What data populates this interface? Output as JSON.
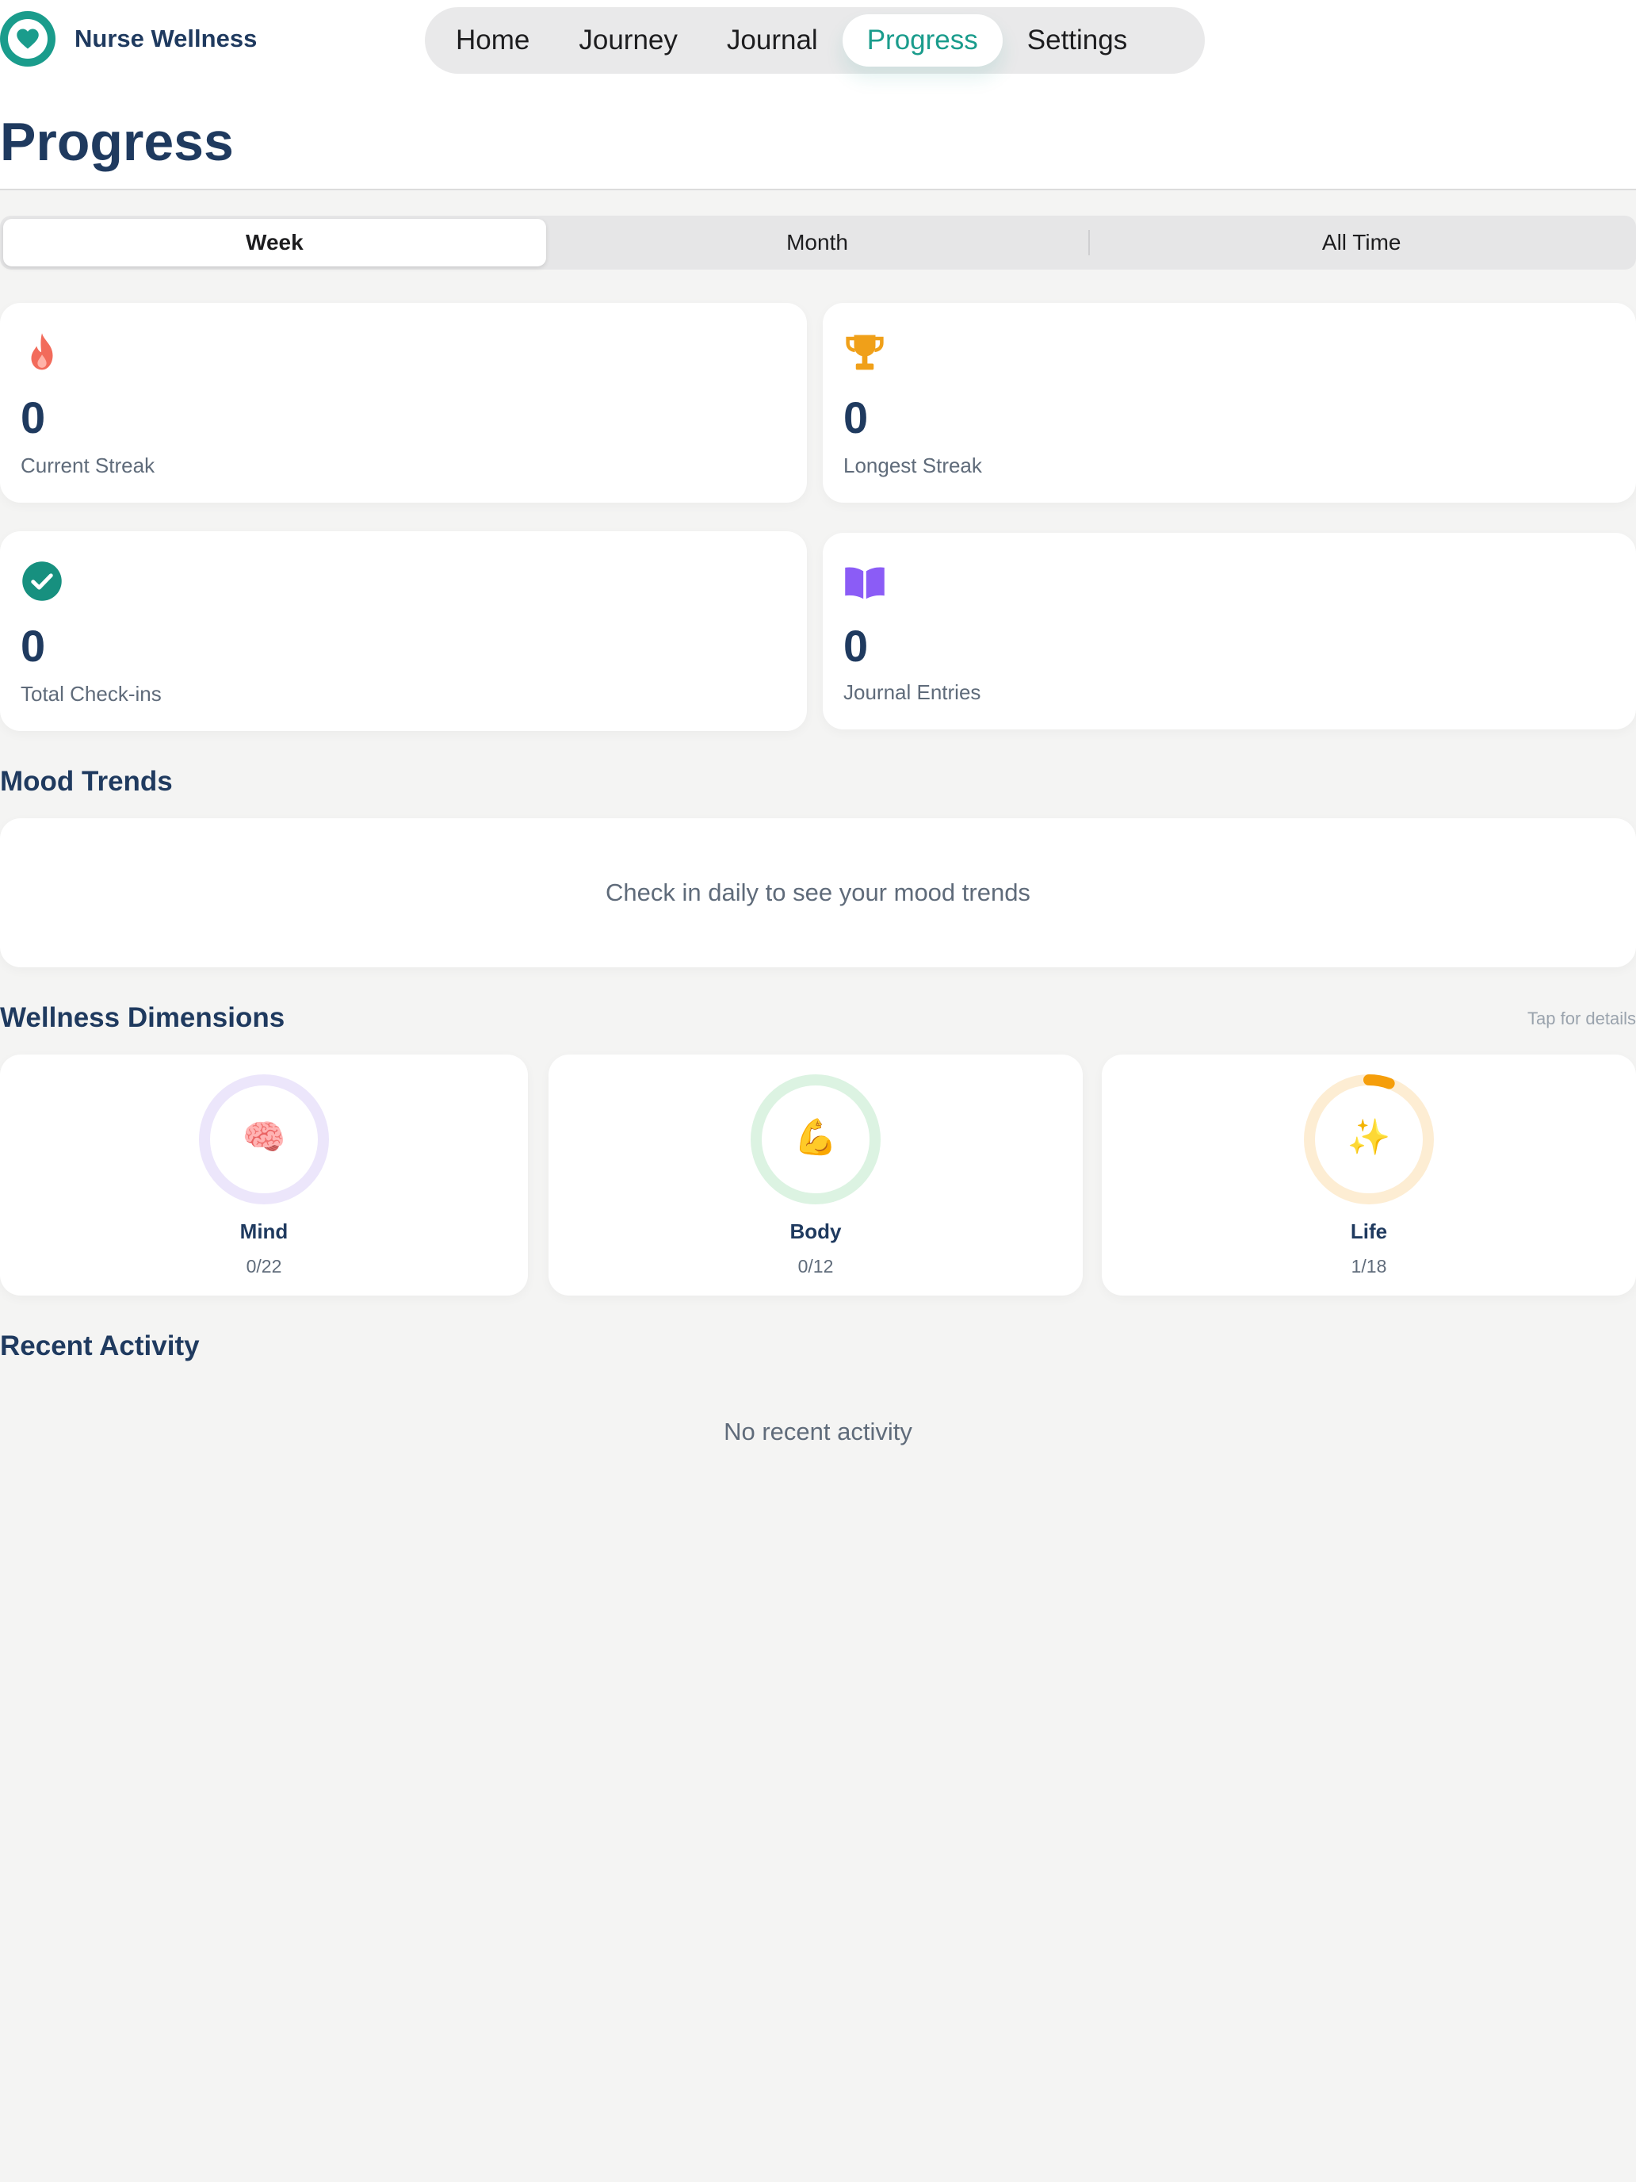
{
  "brand": {
    "name": "Nurse Wellness"
  },
  "nav": {
    "items": [
      {
        "label": "Home"
      },
      {
        "label": "Journey"
      },
      {
        "label": "Journal"
      },
      {
        "label": "Progress",
        "active": true
      },
      {
        "label": "Settings"
      }
    ]
  },
  "page": {
    "title": "Progress"
  },
  "range": {
    "options": [
      "Week",
      "Month",
      "All Time"
    ],
    "selected": "Week"
  },
  "stats": [
    {
      "icon": "flame-icon",
      "value": "0",
      "label": "Current Streak",
      "color": "#f26b5b"
    },
    {
      "icon": "trophy-icon",
      "value": "0",
      "label": "Longest Streak",
      "color": "#f0a019"
    },
    {
      "icon": "check-circle-icon",
      "value": "0",
      "label": "Total Check-ins",
      "color": "#17907f"
    },
    {
      "icon": "open-book-icon",
      "value": "0",
      "label": "Journal Entries",
      "color": "#8b5cf6"
    }
  ],
  "mood": {
    "title": "Mood Trends",
    "empty": "Check in daily to see your mood trends"
  },
  "dimensions": {
    "title": "Wellness Dimensions",
    "hint": "Tap for details",
    "items": [
      {
        "name": "Mind",
        "count": "0/22",
        "done": 0,
        "total": 22,
        "icon": "brain-icon",
        "emoji": "🧠",
        "color": "#8b5cf6",
        "track": "#ece6fb"
      },
      {
        "name": "Body",
        "count": "0/12",
        "done": 0,
        "total": 12,
        "icon": "flexed-arm-icon",
        "emoji": "💪",
        "color": "#22c55e",
        "track": "#dcf3e2"
      },
      {
        "name": "Life",
        "count": "1/18",
        "done": 1,
        "total": 18,
        "icon": "sparkles-icon",
        "emoji": "✨",
        "color": "#f59e0b",
        "track": "#fdedd3"
      }
    ]
  },
  "recent": {
    "title": "Recent Activity",
    "empty": "No recent activity"
  },
  "colors": {
    "accent": "#1a9c8c",
    "heading": "#1f3a5f"
  }
}
